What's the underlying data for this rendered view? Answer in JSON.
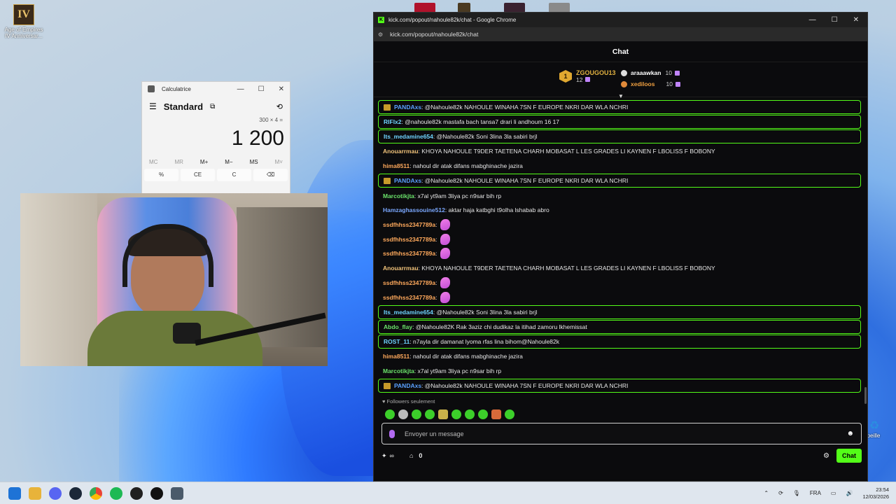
{
  "desktop": {
    "icon_label_line1": "Age of Empires",
    "icon_label_line2": "IV Anniversar...",
    "icon_glyph": "IV",
    "recycle_label": "rbeille"
  },
  "calculator": {
    "title": "Calculatrice",
    "mode": "Standard",
    "expression": "300 × 4 =",
    "result": "1 200",
    "memory": [
      "MC",
      "MR",
      "M+",
      "M−",
      "MS",
      "M˅"
    ],
    "keys": [
      "%",
      "CE",
      "C",
      "⌫"
    ]
  },
  "chrome": {
    "title": "kick.com/popout/nahoule82k/chat - Google Chrome",
    "url": "kick.com/popout/nahoule82k/chat"
  },
  "chat": {
    "header": "Chat",
    "leaderboard": {
      "first": {
        "rank": "1",
        "name": "ZGOUGOU13",
        "count": "12"
      },
      "second": {
        "name": "araaawkan",
        "count": "10"
      },
      "third": {
        "name": "xediloos",
        "count": "10"
      }
    },
    "messages": [
      {
        "user": "PANDAxs",
        "text": ": @Nahoule82k NAHOULE WINAHA 7SN F EUROPE NKRI DAR WLA NCHRI",
        "color": "#5aa0ff",
        "highlight": true,
        "badge": true
      },
      {
        "user": "RIFlx2",
        "text": ": @nahoule82k mastafa bach tansa7 drari li andhoum 16 17",
        "color": "#6fd3ff",
        "highlight": true
      },
      {
        "user": "Its_medamine654",
        "text": ": @Nahoule82k Soni 3lina 3la sabiri brjl",
        "color": "#6fd3ff",
        "highlight": true
      },
      {
        "user": "Anouarrmau",
        "text": ": KHOYA NAHOULE T9DER TAETENA CHARH MOBASAT L LES GRADES LI KAYNEN F LBOLISS F BOBONY",
        "color": "#f0c27a"
      },
      {
        "user": "hima8511",
        "text": ": nahoul dir atak difans mabghinache jazira",
        "color": "#ffa95c"
      },
      {
        "user": "PANDAxs",
        "text": ": @Nahoule82k NAHOULE WINAHA 7SN F EUROPE NKRI DAR WLA NCHRI",
        "color": "#5aa0ff",
        "highlight": true,
        "badge": true
      },
      {
        "user": "Marcotikjta",
        "text": ": x7al yt9am 3liya pc n9sar bih rp",
        "color": "#6be36b"
      },
      {
        "user": "Hamzaghassouine512",
        "text": ": aktar haja katbghi t9olha lshabab abro",
        "color": "#7ba8ff"
      },
      {
        "user": "ssdfhhss2347789a",
        "text": ":",
        "color": "#ffa95c",
        "emote": true
      },
      {
        "user": "ssdfhhss2347789a",
        "text": ":",
        "color": "#ffa95c",
        "emote": true
      },
      {
        "user": "ssdfhhss2347789a",
        "text": ":",
        "color": "#ffa95c",
        "emote": true
      },
      {
        "user": "Anouarrmau",
        "text": ": KHOYA NAHOULE T9DER TAETENA CHARH MOBASAT L LES GRADES LI KAYNEN F LBOLISS F BOBONY",
        "color": "#f0c27a"
      },
      {
        "user": "ssdfhhss2347789a",
        "text": ":",
        "color": "#ffa95c",
        "emote": true
      },
      {
        "user": "ssdfhhss2347789a",
        "text": ":",
        "color": "#ffa95c",
        "emote": true
      },
      {
        "user": "Its_medamine654",
        "text": ": @Nahoule82k Soni 3lina 3la sabiri brjl",
        "color": "#6fd3ff",
        "highlight": true
      },
      {
        "user": "Abdo_flay",
        "text": ": @Nahoule82K Rak 3aziz chi dudikaz la itihad zamoru lkhemissat",
        "color": "#6be36b",
        "highlight": true
      },
      {
        "user": "ROST_11",
        "text": ": n7ayla dir damanat lyoma rfas lina bihom@Nahoule82k",
        "color": "#6fd3ff",
        "highlight": true
      },
      {
        "user": "hima8511",
        "text": ": nahoul dir atak difans mabghinache jazira",
        "color": "#ffa95c"
      },
      {
        "user": "Marcotikjta",
        "text": ": x7al yt9am 3liya pc n9sar bih rp",
        "color": "#6be36b"
      },
      {
        "user": "PANDAxs",
        "text": ": @Nahoule82k NAHOULE WINAHA 7SN F EUROPE NKRI DAR WLA NCHRI",
        "color": "#5aa0ff",
        "highlight": true,
        "badge": true
      }
    ],
    "followers_label": "Followers seulement",
    "input_placeholder": "Envoyer un message",
    "points": "0",
    "send_label": "Chat"
  },
  "taskbar": {
    "language": "FRA",
    "time": "23:54",
    "date": "12/03/2026"
  }
}
